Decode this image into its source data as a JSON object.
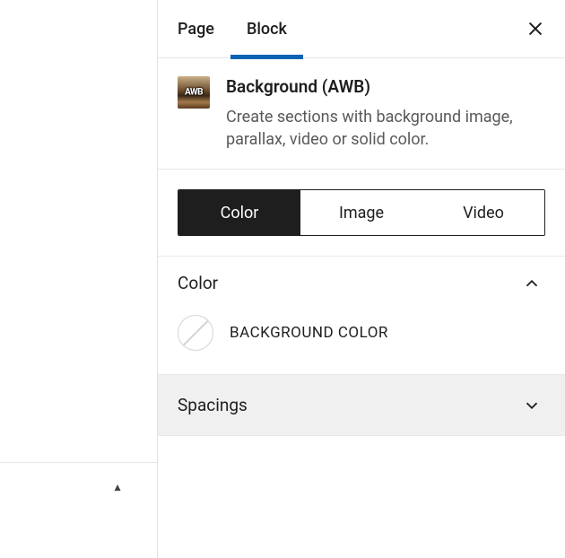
{
  "tabs": {
    "page": "Page",
    "block": "Block"
  },
  "block": {
    "icon_label": "AWB",
    "title": "Background (AWB)",
    "description": "Create sections with background image, parallax, video or solid color."
  },
  "type_options": {
    "color": "Color",
    "image": "Image",
    "video": "Video"
  },
  "panels": {
    "color": {
      "title": "Color",
      "background_color_label": "BACKGROUND COLOR"
    },
    "spacings": {
      "title": "Spacings"
    }
  }
}
